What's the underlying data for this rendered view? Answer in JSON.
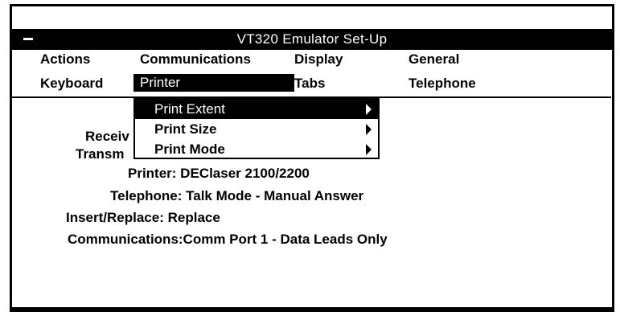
{
  "window": {
    "title": "VT320 Emulator  Set-Up"
  },
  "menubar": {
    "row1": [
      "Actions",
      "Communications",
      "Display",
      "General"
    ],
    "row2": [
      "Keyboard",
      "Printer",
      "Tabs",
      "Telephone"
    ],
    "selected": "Printer"
  },
  "dropdown": {
    "items": [
      {
        "label": "Print Extent",
        "highlighted": true
      },
      {
        "label": "Print Size",
        "highlighted": false
      },
      {
        "label": "Print Mode",
        "highlighted": false
      }
    ]
  },
  "status": {
    "receive_partial": "Receiv",
    "transmit_partial": "Transm",
    "printer": "Printer:   DEClaser 2100/2200",
    "telephone": "Telephone: Talk Mode - Manual Answer",
    "insert_replace": "Insert/Replace:   Replace",
    "communications": "Communications:Comm Port 1 - Data Leads Only"
  }
}
